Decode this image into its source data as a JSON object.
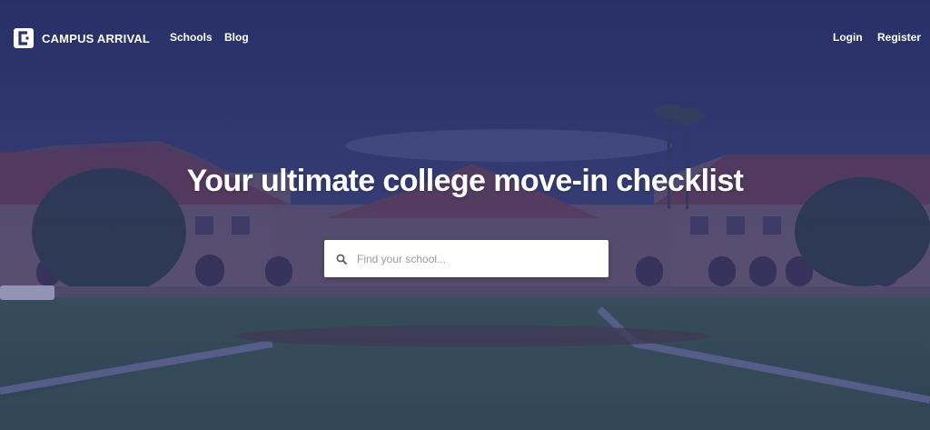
{
  "brand": {
    "name": "CAMPUS ARRIVAL",
    "logo_icon": "campus-arrival-logo-icon"
  },
  "nav": {
    "links": [
      {
        "label": "Schools"
      },
      {
        "label": "Blog"
      }
    ],
    "auth": [
      {
        "label": "Login"
      },
      {
        "label": "Register"
      }
    ]
  },
  "hero": {
    "headline": "Your ultimate college move-in checklist",
    "search": {
      "placeholder": "Find your school...",
      "value": "",
      "icon": "search-icon"
    },
    "background_image": "campus quad with sandstone buildings, palm trees and lawn",
    "overlay_color": "#2d3273"
  },
  "colors": {
    "overlay": "#2d3273",
    "text": "#ffffff",
    "search_bg": "#ffffff"
  }
}
